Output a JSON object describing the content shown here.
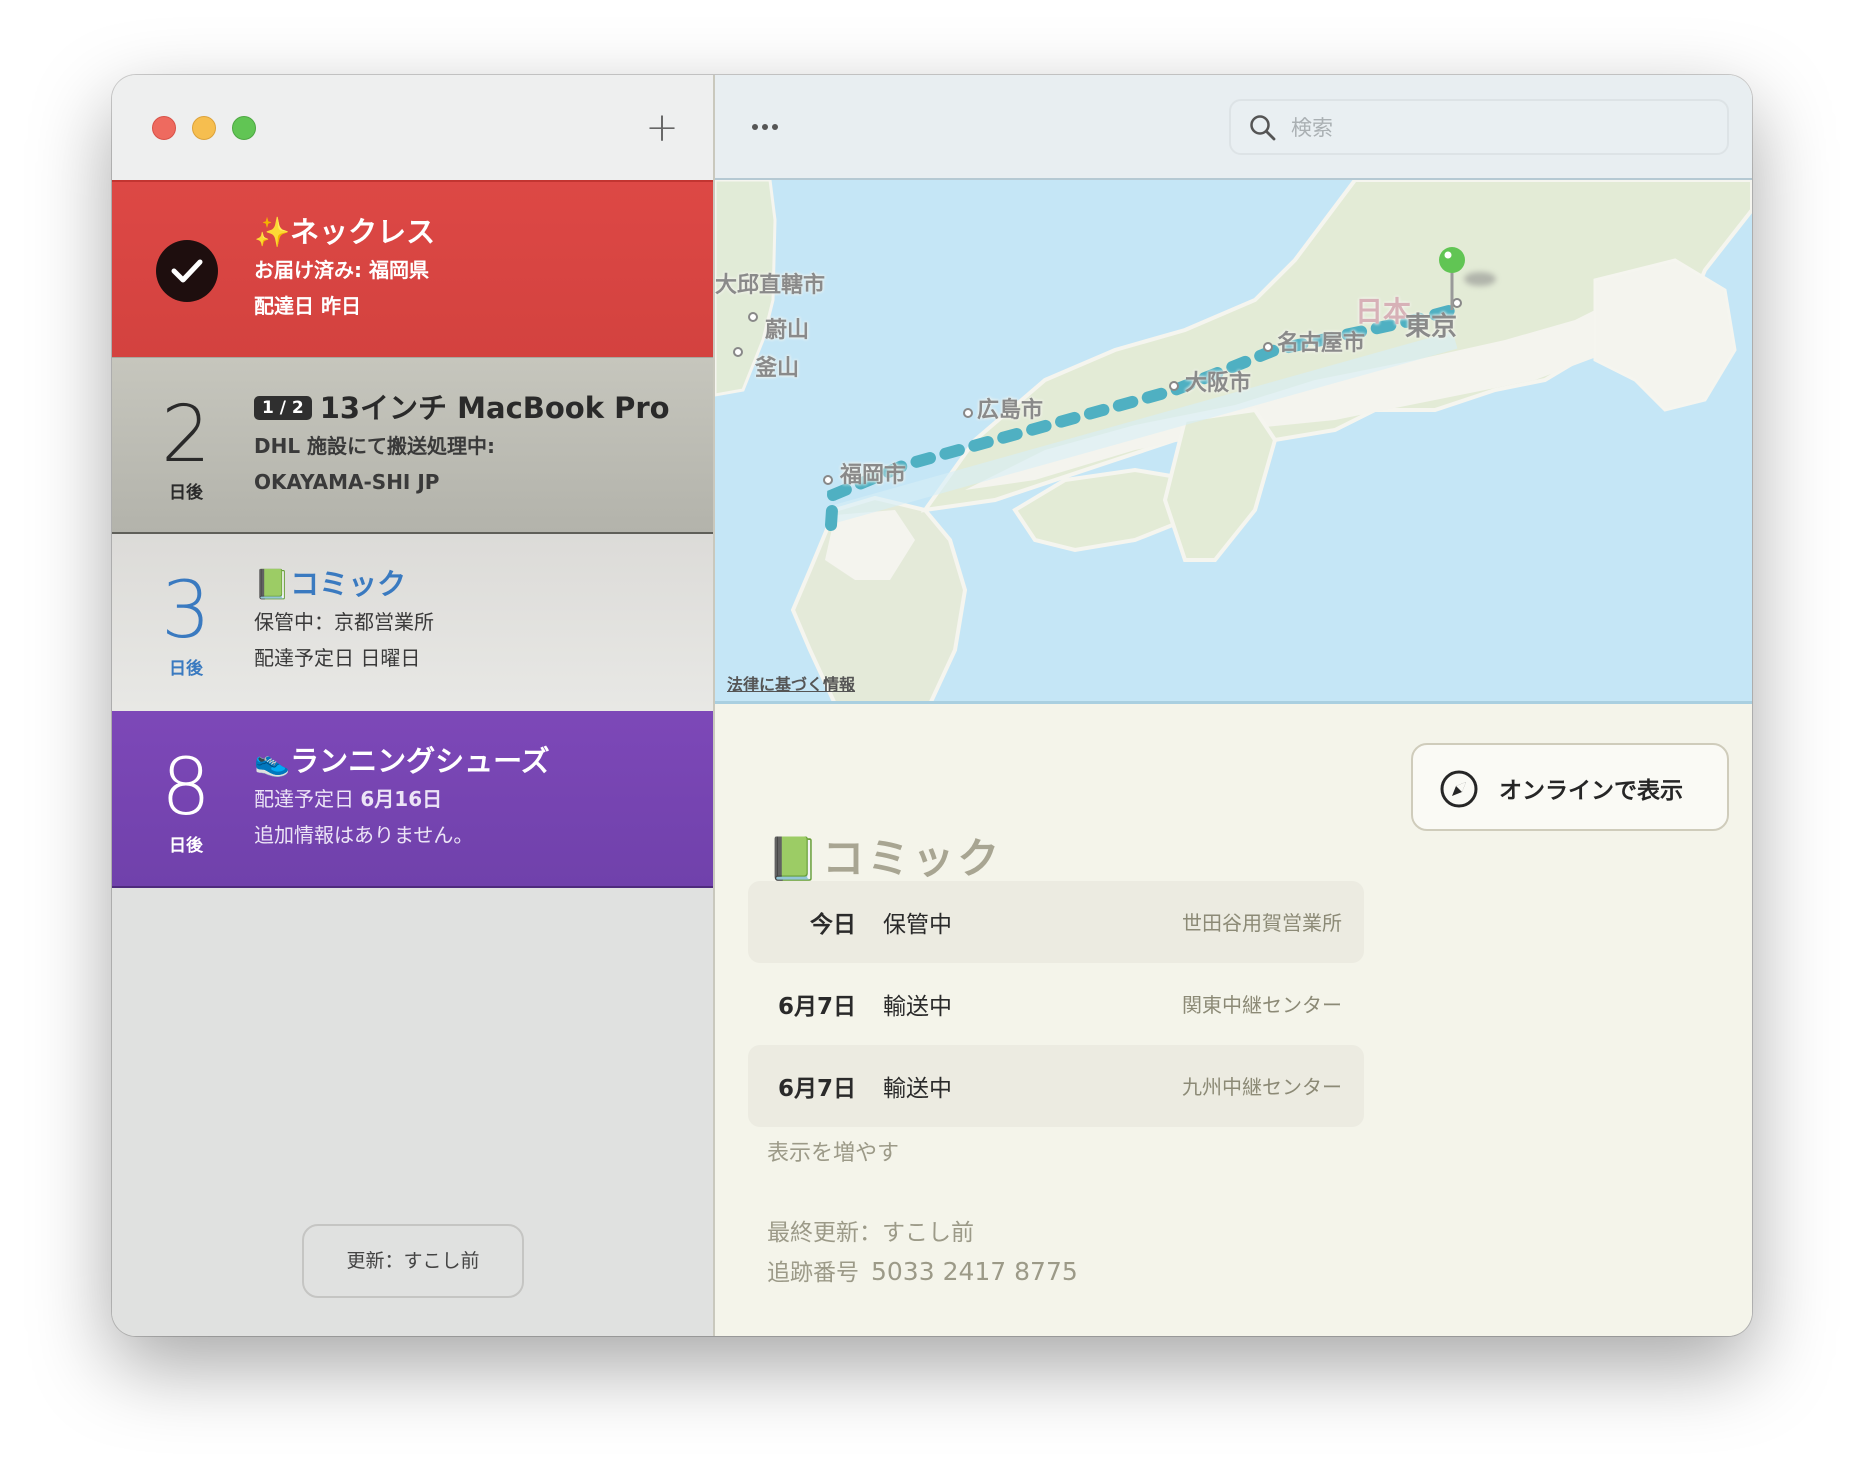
{
  "window": {
    "controls": {
      "close": "close",
      "minimize": "minimize",
      "maximize": "maximize"
    },
    "add_button_label": "+",
    "more_button_label": "...",
    "search": {
      "placeholder": "検索",
      "value": ""
    }
  },
  "sidebar": {
    "packages": [
      {
        "status": "delivered",
        "icon": "checkmark-icon",
        "emoji": "✨",
        "name": "ネックレス",
        "line1": "お届け済み: 福岡県",
        "line2": "配達日 昨日",
        "color": "#d94542"
      },
      {
        "status": "in-transit",
        "days": "2",
        "days_unit": "日後",
        "badge": "1 / 2",
        "name": "13インチ MacBook Pro",
        "line1": "DHL 施設にて搬送処理中: OKAYAMA-SHI JP",
        "color": "#bdbdb5"
      },
      {
        "status": "selected",
        "days": "3",
        "days_unit": "日後",
        "emoji": "📗",
        "name": "コミック",
        "line1": "保管中：京都営業所",
        "line2": "配達予定日 日曜日",
        "color": "#3a7ac0"
      },
      {
        "status": "pending",
        "days": "8",
        "days_unit": "日後",
        "emoji": "👟",
        "name": "ランニングシューズ",
        "line1_prefix": "配達予定日 ",
        "line1_bold": "6月16日",
        "line2": "追加情報はありません。",
        "color": "#7847b5"
      }
    ],
    "refresh_button": "更新：すこし前"
  },
  "map": {
    "labels": {
      "daegu": "大邱直轄市",
      "ulsan": "蔚山",
      "busan": "釜山",
      "japan": "日本",
      "hiroshima": "広島市",
      "fukuoka": "福岡市",
      "osaka": "大阪市",
      "nagoya": "名古屋市",
      "tokyo": "東京"
    },
    "legal_link": "法律に基づく情報",
    "route_color": "#4fb0c2",
    "pin_color": "#61c554"
  },
  "detail": {
    "emoji": "📗",
    "title": "コミック",
    "delivery_date": "配達予定日 日曜日",
    "online_button": "オンラインで表示",
    "events": [
      {
        "date": "今日",
        "status": "保管中",
        "location": "世田谷用賀営業所"
      },
      {
        "date": "6月7日",
        "status": "輸送中",
        "location": "関東中継センター"
      },
      {
        "date": "6月7日",
        "status": "輸送中",
        "location": "九州中継センター"
      }
    ],
    "show_more": "表示を増やす",
    "last_updated": "最終更新：すこし前",
    "tracking_label": "追跡番号",
    "tracking_number": "5033 2417 8775"
  }
}
